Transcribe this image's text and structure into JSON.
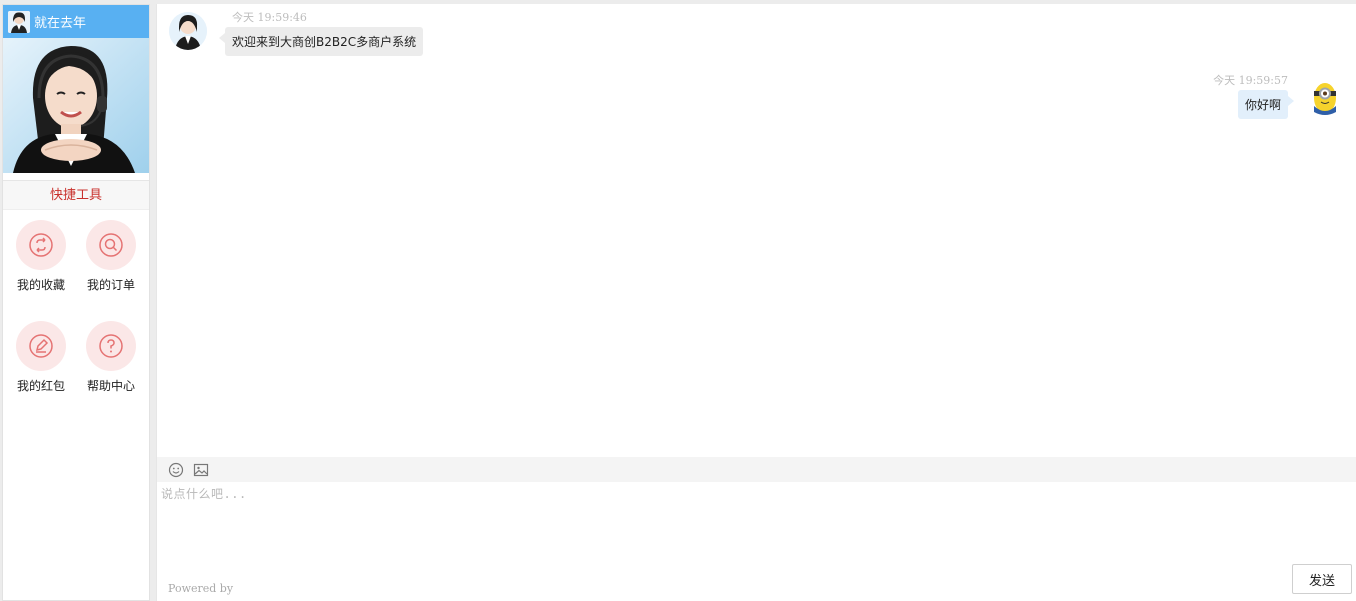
{
  "sidebar": {
    "agent_name": "就在去年",
    "tools_title": "快捷工具",
    "tools": [
      {
        "label": "我的收藏",
        "icon": "favorite-icon"
      },
      {
        "label": "我的订单",
        "icon": "order-search-icon"
      },
      {
        "label": "我的红包",
        "icon": "red-packet-pen-icon"
      },
      {
        "label": "帮助中心",
        "icon": "help-question-icon"
      }
    ]
  },
  "chat": {
    "messages": [
      {
        "side": "left",
        "time": "今天 19:59:46",
        "text": "欢迎来到大商创B2B2C多商户系统"
      },
      {
        "side": "right",
        "time": "今天 19:59:57",
        "text": "你好啊"
      }
    ]
  },
  "composer": {
    "placeholder": "说点什么吧...",
    "send_label": "发送",
    "powered_by": "Powered by"
  },
  "colors": {
    "header_blue": "#58b0f2",
    "tools_title_red": "#c9302c",
    "tool_circle_bg": "#fbe7e7",
    "tool_icon_red": "#e57373"
  }
}
